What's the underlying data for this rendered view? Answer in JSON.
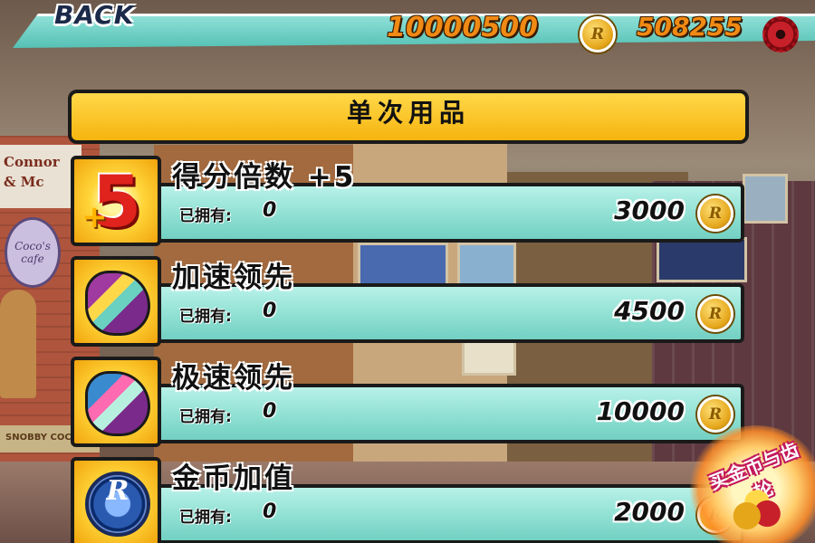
{
  "topbar": {
    "back_label": "BACK",
    "coins": "10000500",
    "gems": "508255",
    "coin_icon": "coin-icon",
    "gem_icon": "gear-gem-icon"
  },
  "category": {
    "title": "单次用品"
  },
  "items": [
    {
      "title": "得分倍数 +5",
      "owned_label": "已拥有:",
      "owned": "0",
      "price": "3000",
      "icon": "score-multiplier-5-icon"
    },
    {
      "title": "加速领先",
      "owned_label": "已拥有:",
      "owned": "0",
      "price": "4500",
      "icon": "head-start-icon"
    },
    {
      "title": "极速领先",
      "owned_label": "已拥有:",
      "owned": "0",
      "price": "10000",
      "icon": "mega-head-start-icon"
    },
    {
      "title": "金币加值",
      "owned_label": "已拥有:",
      "owned": "0",
      "price": "2000",
      "icon": "coin-value-token-icon"
    }
  ],
  "promo": {
    "label": "买金币与齿轮"
  },
  "colors": {
    "accent_teal": "#8fe0d3",
    "header_yellow": "#f6b40e",
    "currency_orange": "#f08a14"
  }
}
